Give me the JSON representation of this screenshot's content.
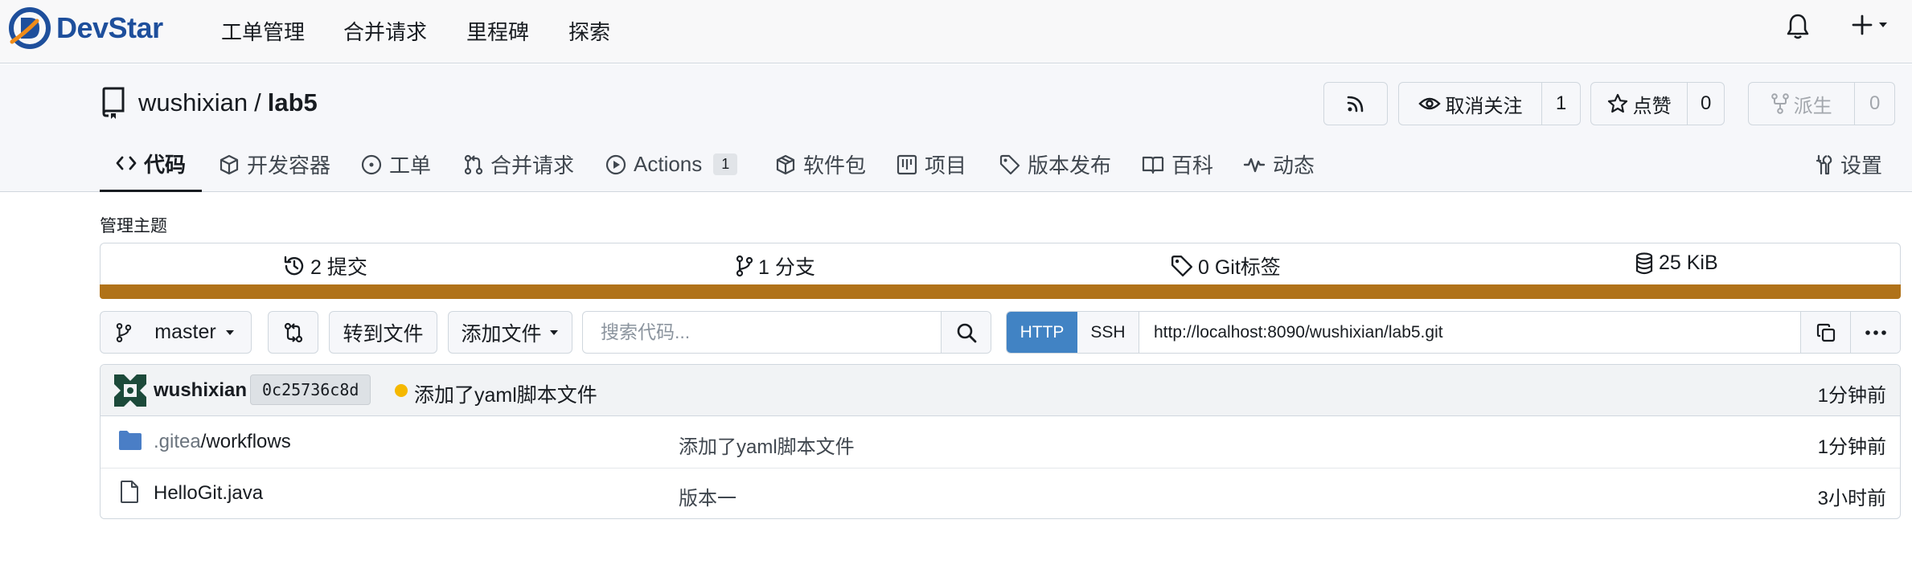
{
  "app": {
    "brand": "DevStar",
    "nav": [
      {
        "label": "工单管理"
      },
      {
        "label": "合并请求"
      },
      {
        "label": "里程碑"
      },
      {
        "label": "探索"
      }
    ],
    "icons": {
      "notifications": "bell-icon",
      "create": "plus-icon"
    }
  },
  "repo": {
    "owner": "wushixian",
    "separator": "/",
    "name": "lab5",
    "rss_icon": "rss-icon",
    "watch": {
      "label": "取消关注",
      "count": "1"
    },
    "star": {
      "label": "点赞",
      "count": "0"
    },
    "fork": {
      "label": "派生",
      "count": "0"
    },
    "tabs": [
      {
        "label": "代码",
        "icon": "code-icon",
        "active": true
      },
      {
        "label": "开发容器",
        "icon": "cube-icon"
      },
      {
        "label": "工单",
        "icon": "issue-opened-icon"
      },
      {
        "label": "合并请求",
        "icon": "pull-request-icon"
      },
      {
        "label": "Actions",
        "icon": "play-icon",
        "badge": "1"
      },
      {
        "label": "软件包",
        "icon": "package-icon"
      },
      {
        "label": "项目",
        "icon": "project-icon"
      },
      {
        "label": "版本发布",
        "icon": "tag-icon"
      },
      {
        "label": "百科",
        "icon": "book-icon"
      },
      {
        "label": "动态",
        "icon": "pulse-icon"
      }
    ],
    "settings_label": "设置"
  },
  "content": {
    "manage_topics": "管理主题",
    "stats": {
      "commits": "2 提交",
      "branches": "1 分支",
      "tags": "0 Git标签",
      "size": "25 KiB"
    },
    "language_color": "#b07219",
    "branch": "master",
    "goto_file": "转到文件",
    "add_file": "添加文件",
    "search": {
      "placeholder": "搜索代码..."
    },
    "clone": {
      "http": "HTTP",
      "ssh": "SSH",
      "url": "http://localhost:8090/wushixian/lab5.git"
    },
    "latest_commit": {
      "author": "wushixian",
      "sha": "0c25736c8d",
      "message": "添加了yaml脚本文件",
      "status_color": "#f5b800",
      "time": "1分钟前"
    },
    "files": [
      {
        "prefix": ".gitea",
        "rest": "/workflows",
        "type": "folder",
        "message": "添加了yaml脚本文件",
        "time": "1分钟前"
      },
      {
        "name": "HelloGit.java",
        "type": "file",
        "message": "版本一",
        "time": "3小时前"
      }
    ]
  }
}
